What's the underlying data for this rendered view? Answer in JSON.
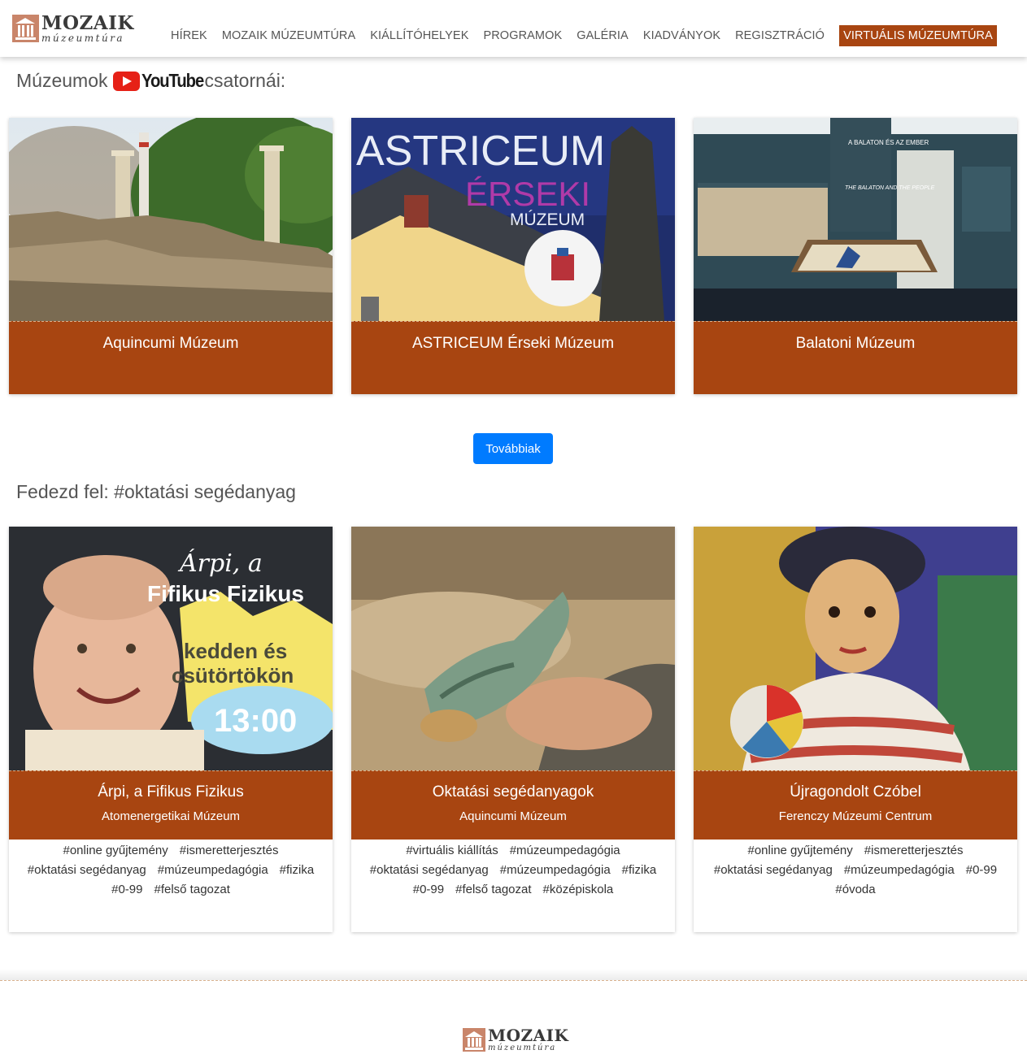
{
  "brand": {
    "name": "MOZAIK",
    "tagline": "múzeumtúra"
  },
  "nav": {
    "items": [
      "HÍREK",
      "MOZAIK MÚZEUMTÚRA",
      "KIÁLLÍTÓHELYEK",
      "PROGRAMOK",
      "GALÉRIA",
      "KIADVÁNYOK",
      "REGISZTRÁCIÓ"
    ],
    "active": "VIRTUÁLIS MÚZEUMTÚRA"
  },
  "youtube_section": {
    "title_before": "Múzeumok",
    "brand_word": "YouTube",
    "title_after": "csatornái:",
    "cards": [
      {
        "title": "Aquincumi Múzeum"
      },
      {
        "title": "ASTRICEUM Érseki Múzeum",
        "image_text": [
          "ASTRICEUM",
          "ÉRSEKI",
          "MÚZEUM"
        ]
      },
      {
        "title": "Balatoni Múzeum",
        "image_text": [
          "A BALATON ÉS AZ EMBER",
          "THE BALATON AND THE PEOPLE"
        ]
      }
    ],
    "more_button": "Továbbiak"
  },
  "edu_section": {
    "title": "Fedezd fel: #oktatási segédanyag",
    "cards": [
      {
        "title": "Árpi, a Fifikus Fizikus",
        "subtitle": "Atomenergetikai Múzeum",
        "image_text": [
          "Árpi, a",
          "Fifikus Fizikus",
          "kedden és",
          "csütörtökön",
          "13:00"
        ],
        "tags": [
          "#online gyűjtemény",
          "#ismeretterjesztés",
          "#oktatási segédanyag",
          "#múzeumpedagógia",
          "#fizika",
          "#0-99",
          "#felső tagozat"
        ]
      },
      {
        "title": "Oktatási segédanyagok",
        "subtitle": "Aquincumi Múzeum",
        "tags": [
          "#virtuális kiállítás",
          "#múzeumpedagógia",
          "#oktatási segédanyag",
          "#múzeumpedagógia",
          "#fizika",
          "#0-99",
          "#felső tagozat",
          "#középiskola"
        ]
      },
      {
        "title": "Újragondolt Czóbel",
        "subtitle": "Ferenczy Múzeumi Centrum",
        "tags": [
          "#online gyűjtemény",
          "#ismeretterjesztés",
          "#oktatási segédanyag",
          "#múzeumpedagógia",
          "#0-99",
          "#óvoda"
        ]
      }
    ]
  },
  "colors": {
    "accent": "#a84511",
    "button": "#007bff",
    "youtube_red": "#e62117"
  },
  "icons": [
    "museum-logo-icon",
    "youtube-play-icon"
  ]
}
